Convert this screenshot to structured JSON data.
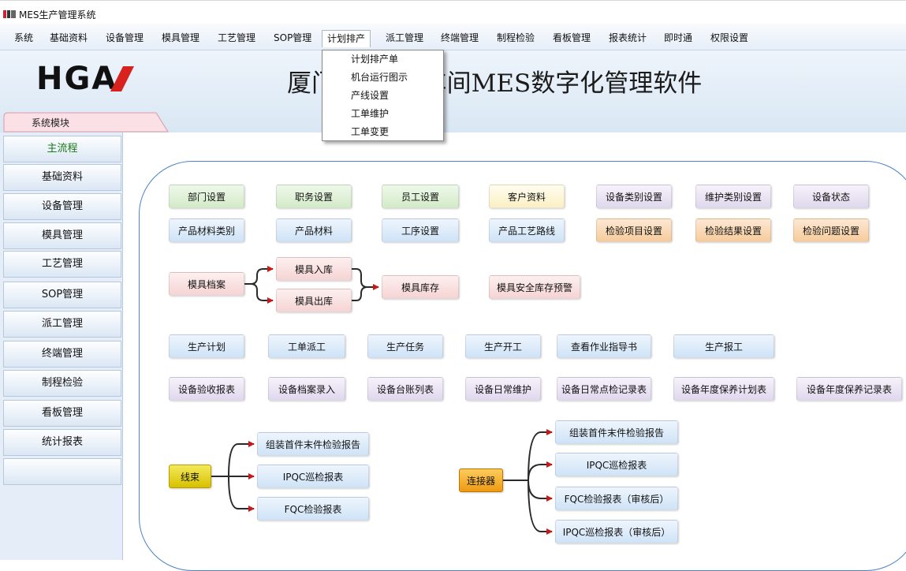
{
  "window": {
    "title": "MES生产管理系统"
  },
  "menu": {
    "items": [
      "系统",
      "基础资料",
      "设备管理",
      "模具管理",
      "工艺管理",
      "SOP管理",
      "计划排产",
      "派工管理",
      "终端管理",
      "制程检验",
      "看板管理",
      "报表统计",
      "即时通",
      "权限设置"
    ],
    "active": "计划排产"
  },
  "dropdown": {
    "items": [
      "计划排产单",
      "机台运行图示",
      "产线设置",
      "工单维护",
      "工单变更"
    ]
  },
  "header": {
    "logo_text": "HGA",
    "title": "厦门██生产车间MES数字化管理软件"
  },
  "sidebar": {
    "tab_label": "系统模块",
    "items": [
      "主流程",
      "基础资料",
      "设备管理",
      "模具管理",
      "工艺管理",
      "SOP管理",
      "派工管理",
      "终端管理",
      "制程检验",
      "看板管理",
      "统计报表"
    ],
    "active": "主流程"
  },
  "flow": {
    "row1": [
      "部门设置",
      "职务设置",
      "员工设置",
      "客户资料",
      "设备类别设置",
      "维护类别设置",
      "设备状态"
    ],
    "row2": [
      "产品材料类别",
      "产品材料",
      "工序设置",
      "产品工艺路线",
      "检验项目设置",
      "检验结果设置",
      "检验问题设置"
    ],
    "mold": {
      "archive": "模具档案",
      "in": "模具入库",
      "out": "模具出库",
      "stock": "模具库存",
      "warning": "模具安全库存预警"
    },
    "row4": [
      "生产计划",
      "工单派工",
      "生产任务",
      "生产开工",
      "查看作业指导书",
      "生产报工"
    ],
    "row5": [
      "设备验收报表",
      "设备档案录入",
      "设备台账列表",
      "设备日常维护",
      "设备日常点检记录表",
      "设备年度保养计划表",
      "设备年度保养记录表"
    ],
    "harness": {
      "tag": "线束",
      "reports": [
        "组装首件末件检验报告",
        "IPQC巡检报表",
        "FQC检验报表"
      ]
    },
    "connector": {
      "tag": "连接器",
      "reports": [
        "组装首件末件检验报告",
        "IPQC巡检报表",
        "FQC检验报表（审核后）",
        "IPQC巡检报表（审核后）"
      ]
    }
  }
}
